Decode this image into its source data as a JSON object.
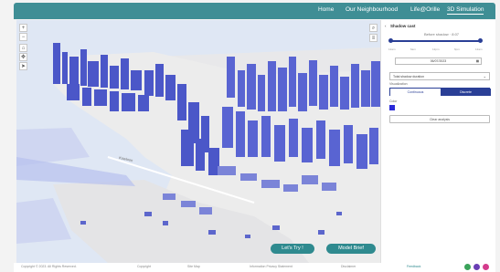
{
  "nav": {
    "items": [
      "Home",
      "Our Neighbourhood",
      "Life@Orille",
      "3D Simulation"
    ],
    "active": "3D Simulation"
  },
  "map": {
    "zoom_in": "+",
    "zoom_out": "−",
    "road_label": "Kowloon",
    "buttons": {
      "try": "Let's Try !",
      "brief": "Model Brief"
    }
  },
  "panel": {
    "title": "Shadow cast",
    "time_label": "Before shadow · 8:07",
    "ticks": [
      "12am",
      "6am",
      "12pm",
      "6pm",
      "12am"
    ],
    "date": "06/07/2023",
    "type_select": "Total shadow duration",
    "visualization_label": "Visualization",
    "toggle": [
      "Continuous",
      "Discrete"
    ],
    "toggle_active": "Discrete",
    "color_label": "Color",
    "clear_button": "Clear analysis"
  },
  "footer": {
    "copyright": "Copyright © 2023. All Rights Reserved.",
    "links": [
      "Copyright",
      "Site Map",
      "Information Privacy Statement",
      "Disclaimer"
    ],
    "feedback": "Feedback"
  },
  "colors": {
    "nav_bg": "#3f8e95",
    "accent": "#2a3f96",
    "button": "#2f8a8f",
    "shadow_color": "#2a2ad8",
    "water": "#dfe7f4"
  }
}
